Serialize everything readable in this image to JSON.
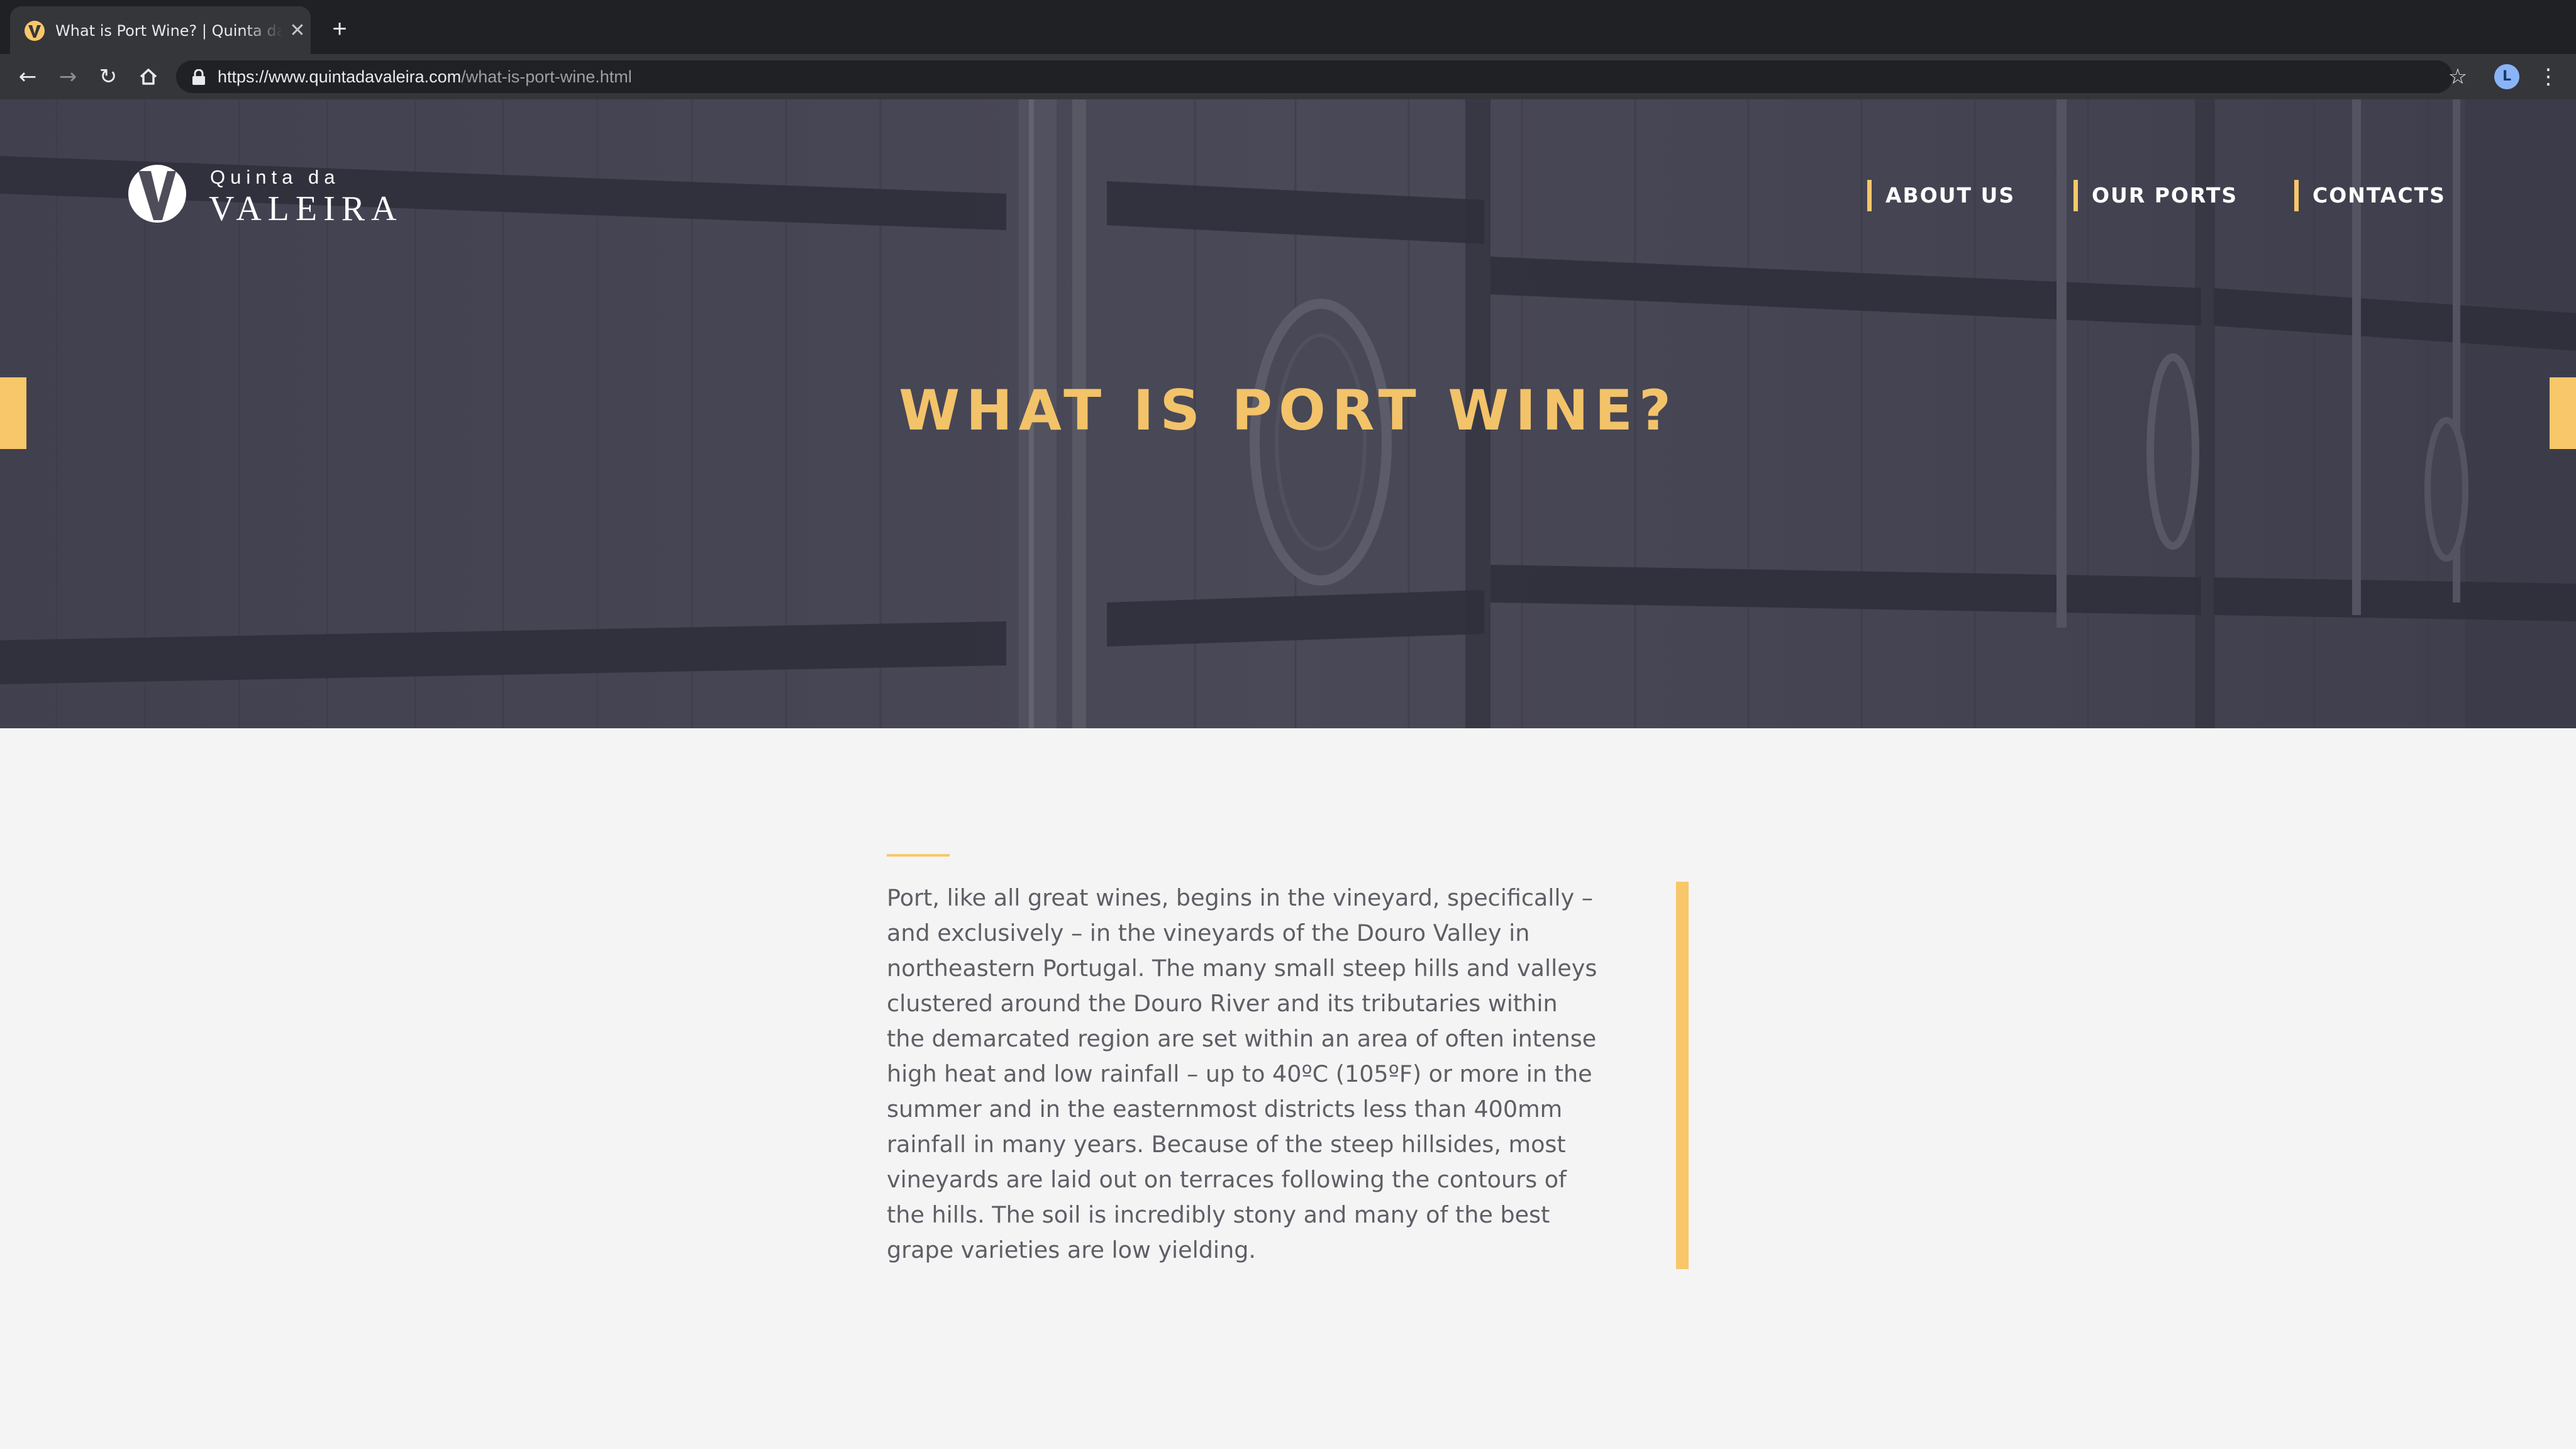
{
  "browser": {
    "tab_title": "What is Port Wine? | Quinta da Valeira",
    "tab_close": "✕",
    "new_tab": "+",
    "url_host": "https://www.quintadavaleira.com",
    "url_path": "/what-is-port-wine.html",
    "profile_initial": "L",
    "icons": [
      "back-arrow-icon",
      "forward-arrow-icon",
      "reload-icon",
      "home-icon",
      "lock-icon",
      "star-icon",
      "menu-icon"
    ]
  },
  "site": {
    "logo_small": "Quinta da",
    "logo_big": "VALEIRA",
    "nav": [
      {
        "label": "ABOUT US"
      },
      {
        "label": "OUR PORTS"
      },
      {
        "label": "CONTACTS"
      }
    ],
    "hero_title": "WHAT IS PORT WINE?",
    "body": "Port, like all great wines, begins in the vineyard, specifically – and exclusively – in the vineyards of the Douro Valley in northeastern Portugal. The many small steep hills and valleys clustered around the Douro River and its tributaries within the demarcated region are set within an area of often intense high heat and low rainfall – up to 40ºC (105ºF) or more in the summer and in the easternmost districts less than 400mm rainfall in many years. Because of the steep hillsides, most vineyards are laid out on terraces following the contours of the hills. The soil is incredibly stony and many of the best grape varieties are low yielding."
  },
  "colors": {
    "accent": "#f8c76a",
    "title": "#f3c36a",
    "hero_overlay": "#45445a",
    "page_bg": "#f4f4f4",
    "body_text": "#5e5e66",
    "chrome_dark": "#202124",
    "chrome_mid": "#35363a"
  }
}
